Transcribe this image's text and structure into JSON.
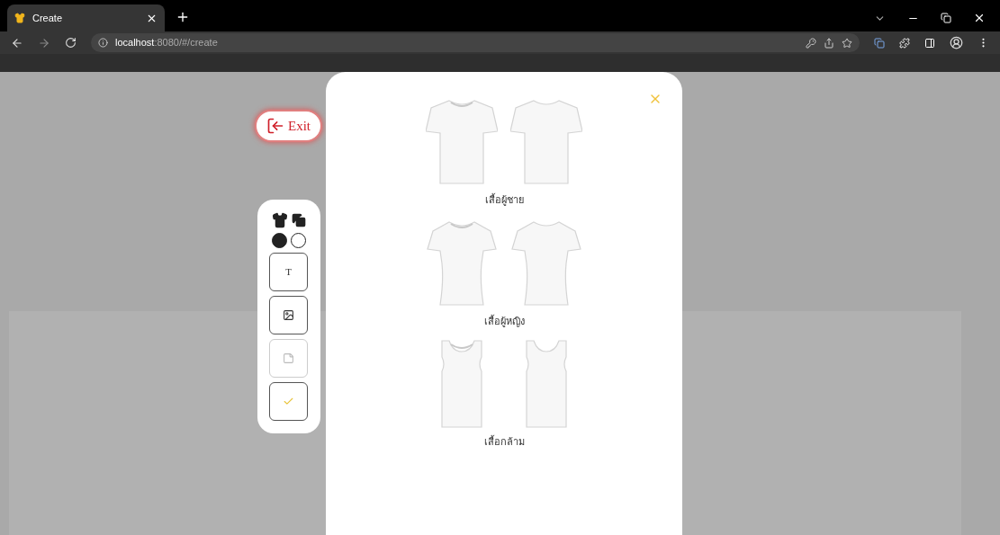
{
  "browser": {
    "tab_title": "Create",
    "url_host": "localhost",
    "url_rest": ":8080/#/create"
  },
  "exit_button": {
    "label": "Exit"
  },
  "toolbar": {
    "colors": [
      {
        "color": "#222222"
      },
      {
        "color": "#ffffff"
      }
    ],
    "tools": [
      {
        "kind": "text",
        "glyph": "T",
        "disabled": false
      },
      {
        "kind": "image",
        "disabled": false
      },
      {
        "kind": "note",
        "disabled": true
      },
      {
        "kind": "confirm",
        "disabled": false
      }
    ]
  },
  "modal": {
    "categories": [
      {
        "kind": "tshirt",
        "label": "เสื้อผู้ชาย"
      },
      {
        "kind": "womens",
        "label": "เสื้อผู้หญิง"
      },
      {
        "kind": "tank",
        "label": "เสื้อกล้าม"
      }
    ]
  }
}
